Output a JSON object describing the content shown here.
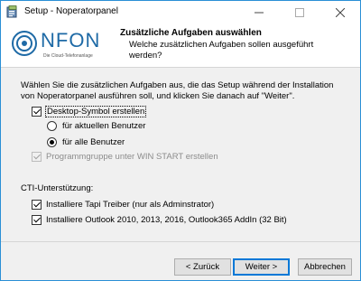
{
  "window": {
    "title": "Setup - Noperatorpanel",
    "controls": [
      "minimize",
      "maximize",
      "close"
    ]
  },
  "logo": {
    "wordmark": "NFON",
    "tagline": "Die Cloud-Telefonanlage"
  },
  "header": {
    "title": "Zusätzliche Aufgaben auswählen",
    "subtitle": "Welche zusätzlichen Aufgaben sollen ausgeführt werden?"
  },
  "intro": "Wählen Sie die zusätzlichen Aufgaben aus, die das Setup während der Installation von Noperatorpanel ausführen soll, und klicken Sie danach auf \"Weiter\".",
  "tasks": {
    "desktop_icon": {
      "label": "Desktop-Symbol erstellen",
      "checked": true
    },
    "radio_current_user": {
      "label": "für aktuellen Benutzer",
      "selected": false
    },
    "radio_all_users": {
      "label": "für alle Benutzer",
      "selected": true
    },
    "program_group": {
      "label": "Programmgruppe unter WIN START erstellen",
      "checked": true,
      "disabled": true
    }
  },
  "cti": {
    "heading": "CTI-Unterstützung:",
    "tapi": {
      "label": "Installiere Tapi Treiber (nur als Adminstrator)",
      "checked": true
    },
    "outlook": {
      "label": "Installiere Outlook 2010, 2013, 2016, Outlook365 AddIn (32 Bit)",
      "checked": true
    }
  },
  "buttons": {
    "back": "< Zurück",
    "next": "Weiter >",
    "cancel": "Abbrechen"
  },
  "colors": {
    "accent": "#0078d7",
    "window_border": "#2a8fd6",
    "logo_blue": "#1e6aa6",
    "dialog_bg": "#f0f0f0"
  }
}
